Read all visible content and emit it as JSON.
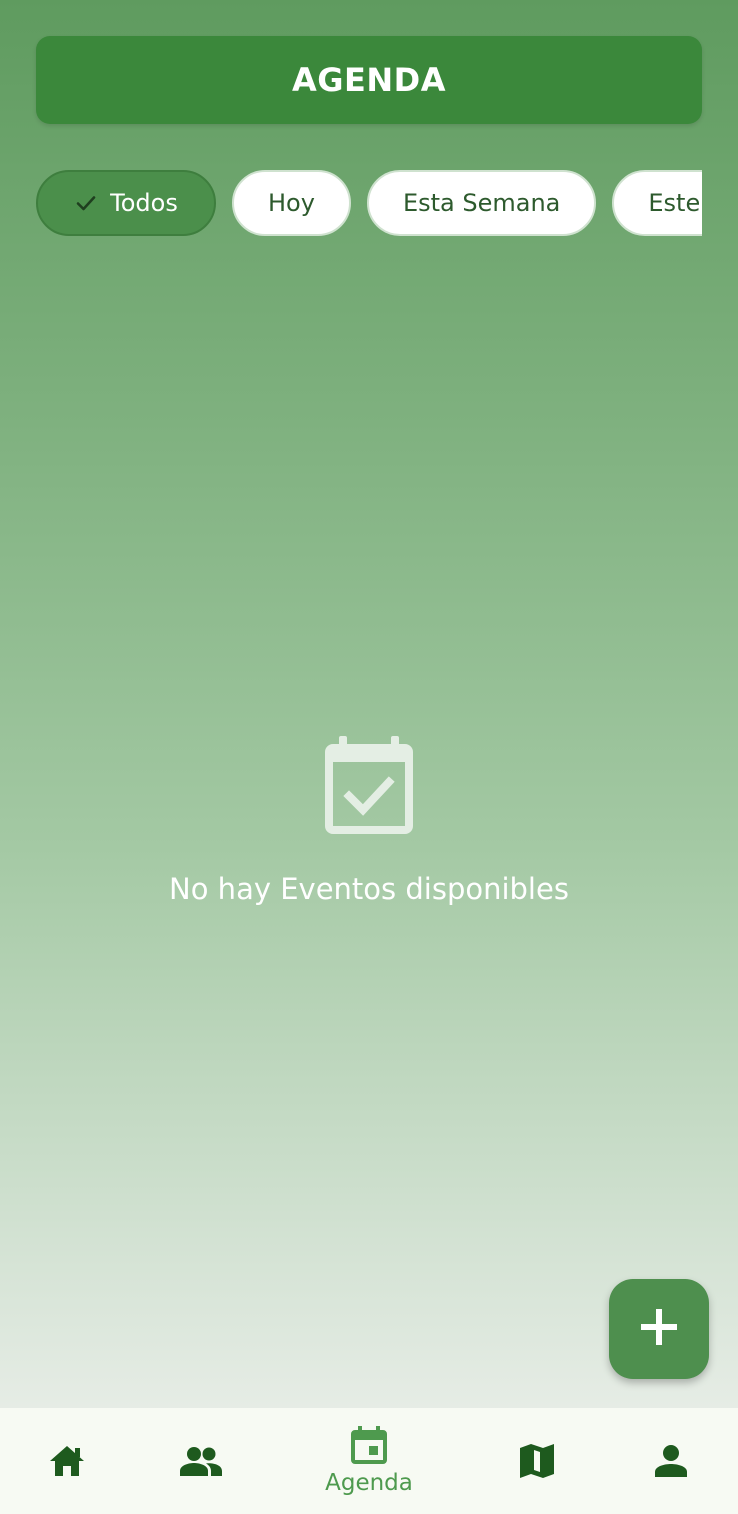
{
  "header": {
    "title": "AGENDA"
  },
  "filters": {
    "chips": [
      {
        "label": "Todos",
        "selected": true
      },
      {
        "label": "Hoy",
        "selected": false
      },
      {
        "label": "Esta Semana",
        "selected": false
      },
      {
        "label": "Este Mes",
        "selected": false
      }
    ]
  },
  "empty_state": {
    "icon": "event-available-icon",
    "message": "No hay Eventos disponibles"
  },
  "fab": {
    "icon": "plus-icon"
  },
  "bottom_nav": {
    "items": [
      {
        "icon": "home-icon",
        "label": "",
        "active": false
      },
      {
        "icon": "people-icon",
        "label": "",
        "active": false
      },
      {
        "icon": "calendar-icon",
        "label": "Agenda",
        "active": true
      },
      {
        "icon": "map-icon",
        "label": "",
        "active": false
      },
      {
        "icon": "person-icon",
        "label": "",
        "active": false
      }
    ]
  },
  "colors": {
    "header_bg": "#3b883b",
    "chip_selected_bg": "#4b8f4b",
    "chip_text": "#2d5a2d",
    "fab_bg": "#4e8f4e",
    "nav_icon": "#1e5a1e",
    "nav_active": "#4e9a4e"
  }
}
